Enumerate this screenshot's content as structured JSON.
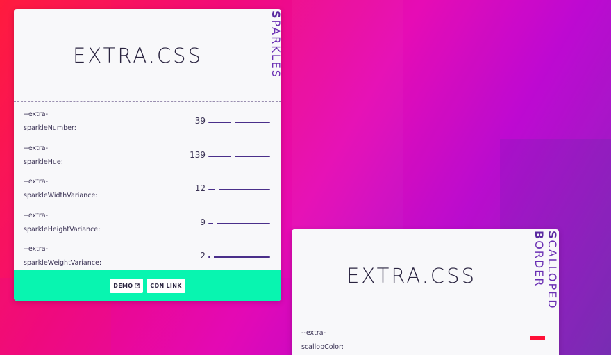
{
  "colors": {
    "accent": "#6a2fb3",
    "footer": "#08f5b0",
    "swatch": "#ff1037"
  },
  "cards": [
    {
      "title": "EXTRA.CSS",
      "side_label_first": "S",
      "side_label_rest": "PARKLES",
      "properties": [
        {
          "name_line1": "--extra-",
          "name_line2": "sparkleNumber:",
          "value": "39",
          "fraction": 0.39
        },
        {
          "name_line1": "--extra-",
          "name_line2": "sparkleHue:",
          "value": "139",
          "fraction": 0.39
        },
        {
          "name_line1": "--extra-",
          "name_line2": "sparkleWidthVariance:",
          "value": "12",
          "fraction": 0.12
        },
        {
          "name_line1": "--extra-",
          "name_line2": "sparkleHeightVariance:",
          "value": "9",
          "fraction": 0.09
        },
        {
          "name_line1": "--extra-",
          "name_line2": "sparkleWeightVariance:",
          "value": "2",
          "fraction": 0.02
        }
      ],
      "buttons": {
        "demo": "DEMO",
        "cdn": "CDN LINK"
      },
      "icons": {
        "demo": "external-link-icon"
      }
    },
    {
      "title": "EXTRA.CSS",
      "side_label_line1_first": "S",
      "side_label_line1_rest": "CALLOPED",
      "side_label_line2_first": "B",
      "side_label_line2_rest": "ORDER",
      "properties": [
        {
          "name_line1": "--extra-",
          "name_line2": "scallopColor:",
          "swatch": "#ff1037"
        }
      ]
    }
  ]
}
